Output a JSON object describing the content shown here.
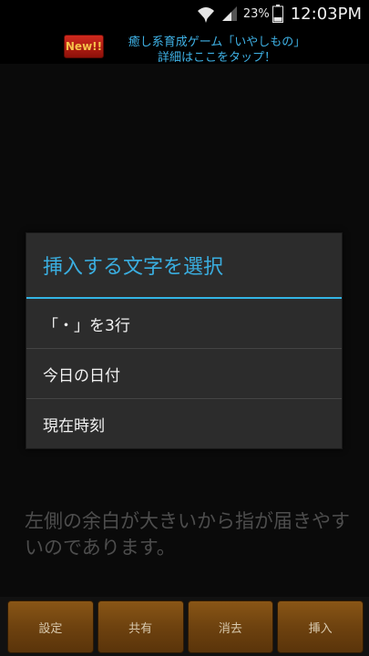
{
  "status_bar": {
    "battery_percent": "23%",
    "time": "12:03PM",
    "icons": [
      "wifi-icon",
      "signal-icon",
      "battery-icon"
    ]
  },
  "ad": {
    "badge": "New!!",
    "line1": "癒し系育成ゲーム「いやしもの」",
    "line2": "詳細はここをタップ！"
  },
  "body_text": "左側の余白が大きいから指が届きやすいのであります。",
  "dialog": {
    "title": "挿入する文字を選択",
    "items": [
      {
        "label": "「・」を3行"
      },
      {
        "label": "今日の日付"
      },
      {
        "label": "現在時刻"
      }
    ]
  },
  "toolbar": {
    "settings": "設定",
    "share": "共有",
    "delete": "消去",
    "insert": "挿入"
  },
  "colors": {
    "accent": "#33b5e5",
    "button": "#7a4a12"
  }
}
